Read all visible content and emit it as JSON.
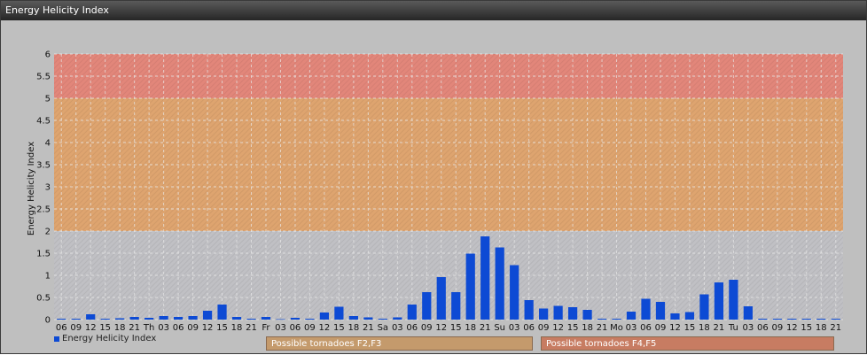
{
  "window": {
    "title": "Energy Helicity Index"
  },
  "legend": {
    "label": "Energy Helicity Index",
    "color": "#0d4ad4"
  },
  "bands": [
    {
      "label": "Possible tornadoes F2,F3",
      "color": "#c49a6c"
    },
    {
      "label": "Possible tornadoes F4,F5",
      "color": "#c77c62"
    }
  ],
  "colors": {
    "bar": "#0d4ad4",
    "background": "#bfbfbf",
    "zone_low": "#c0c0c4",
    "zone_mid": "#dea46f",
    "zone_high": "#e2867a",
    "grid": "#e9e9e9"
  },
  "chart_data": {
    "type": "bar",
    "ylabel": "Energy Helicity Index",
    "xlabel": "",
    "ylim": [
      0,
      6
    ],
    "yticks": [
      "0",
      "0.5",
      "1",
      "1.5",
      "2",
      "2.5",
      "3",
      "3.5",
      "4",
      "4.5",
      "5",
      "5.5",
      "6"
    ],
    "zones": [
      {
        "from": 0,
        "to": 2,
        "label": ""
      },
      {
        "from": 2,
        "to": 5,
        "label": "Possible tornadoes F2,F3"
      },
      {
        "from": 5,
        "to": 6,
        "label": "Possible tornadoes F4,F5"
      }
    ],
    "grid": true,
    "legend_position": "bottom-left",
    "categories": [
      "06",
      "09",
      "12",
      "15",
      "18",
      "21",
      "Th",
      "03",
      "06",
      "09",
      "12",
      "15",
      "18",
      "21",
      "Fr",
      "03",
      "06",
      "09",
      "12",
      "15",
      "18",
      "21",
      "Sa",
      "03",
      "06",
      "09",
      "12",
      "15",
      "18",
      "21",
      "Su",
      "03",
      "06",
      "09",
      "12",
      "15",
      "18",
      "21",
      "Mo",
      "03",
      "06",
      "09",
      "12",
      "15",
      "18",
      "21",
      "Tu",
      "03",
      "06",
      "09",
      "12",
      "15",
      "18",
      "21"
    ],
    "series": [
      {
        "name": "Energy Helicity Index",
        "values": [
          0.02,
          0.02,
          0.12,
          0.02,
          0.03,
          0.06,
          0.04,
          0.08,
          0.06,
          0.08,
          0.2,
          0.34,
          0.06,
          0.02,
          0.06,
          0.01,
          0.04,
          0.02,
          0.16,
          0.29,
          0.08,
          0.05,
          0.02,
          0.05,
          0.34,
          0.62,
          0.96,
          0.62,
          1.49,
          1.88,
          1.63,
          1.23,
          0.44,
          0.25,
          0.31,
          0.28,
          0.22,
          0.02,
          0.02,
          0.18,
          0.47,
          0.4,
          0.14,
          0.17,
          0.57,
          0.84,
          0.9,
          0.3,
          0.02,
          0.02,
          0.02,
          0.02,
          0.02,
          0.02
        ]
      }
    ]
  }
}
